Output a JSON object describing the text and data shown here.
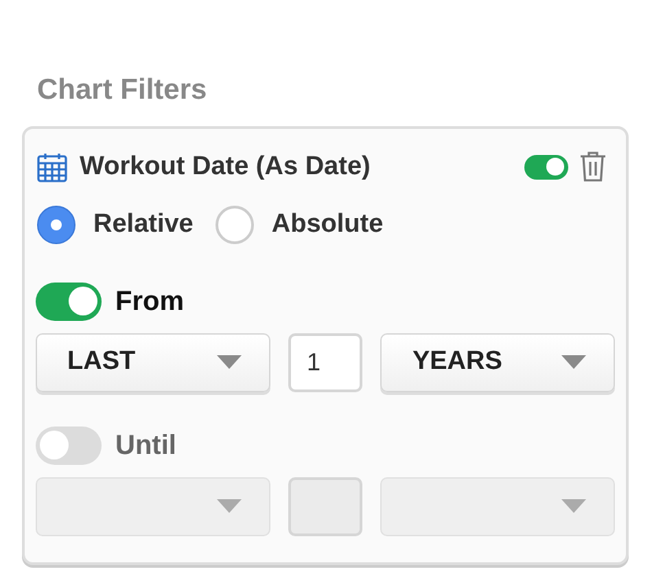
{
  "title": "Chart Filters",
  "filter": {
    "name": "Workout Date (As Date)",
    "enabled": true,
    "modes": [
      {
        "label": "Relative",
        "selected": true
      },
      {
        "label": "Absolute",
        "selected": false
      }
    ],
    "ranges": [
      {
        "label": "From",
        "on": true,
        "direction": "LAST",
        "amount": "1",
        "unit": "YEARS"
      },
      {
        "label": "Until",
        "on": false
      }
    ]
  }
}
